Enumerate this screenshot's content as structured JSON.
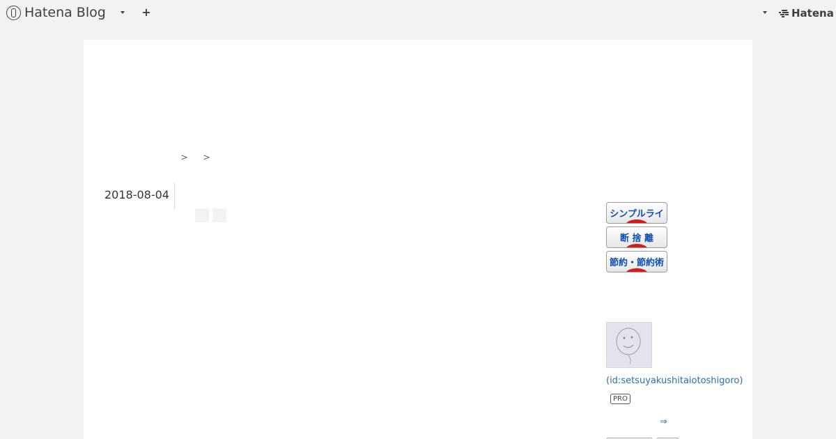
{
  "header": {
    "logo_text": "Hatena Blog",
    "plus_label": "+",
    "brand_text": "Hatena",
    "icons": {
      "logo": "hatena-blog-logo-icon",
      "menu_caret": "chevron-down-icon",
      "brand": "hatena-logo-icon"
    }
  },
  "breadcrumb": {
    "separators": [
      ">",
      ">"
    ]
  },
  "entry": {
    "date": "2018-08-04"
  },
  "sidebar": {
    "banners": [
      {
        "label": "シンプルライフ"
      },
      {
        "label": "断 捨 離"
      },
      {
        "label": "節約・節約術"
      }
    ],
    "profile": {
      "id_text": "(id:setsuyakushitaiotoshigoro)",
      "badge": "PRO",
      "readmore": "⇒"
    }
  },
  "colors": {
    "background": "#f2f2f2",
    "content": "#ffffff",
    "link": "#2a6fb0",
    "banner_text": "#0b4fb3",
    "banner_accent": "#d61a1a"
  }
}
